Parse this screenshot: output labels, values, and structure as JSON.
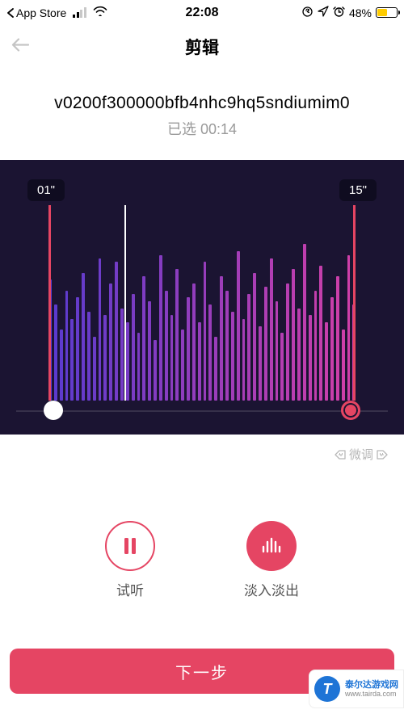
{
  "status_bar": {
    "back_app": "App Store",
    "time": "22:08",
    "battery_percent": "48%",
    "battery_fill": 48
  },
  "header": {
    "title": "剪辑"
  },
  "file": {
    "name": "v0200f300000bfb4nhc9hq5sndiumim0",
    "selected_label": "已选 00:14"
  },
  "waveform": {
    "start_label": "01\"",
    "end_label": "15\"",
    "fine_tune_label": "微调",
    "bars": [
      68,
      54,
      40,
      62,
      46,
      58,
      72,
      50,
      36,
      80,
      48,
      66,
      78,
      52,
      44,
      60,
      38,
      70,
      56,
      34,
      82,
      62,
      48,
      74,
      40,
      58,
      66,
      44,
      78,
      54,
      36,
      70,
      62,
      50,
      84,
      46,
      60,
      72,
      42,
      64,
      80,
      56,
      38,
      66,
      74,
      52,
      88,
      48,
      62,
      76,
      44,
      58,
      70,
      40,
      82,
      54
    ]
  },
  "actions": {
    "preview_label": "试听",
    "fade_label": "淡入淡出"
  },
  "primary": {
    "next_label": "下一步"
  },
  "watermark": {
    "brand": "泰尔达游戏网",
    "url": "www.tairda.com"
  },
  "colors": {
    "accent": "#e54563",
    "wave_start": "#5a3bcf",
    "wave_end": "#d13fa8",
    "panel_bg": "#1b1432"
  }
}
